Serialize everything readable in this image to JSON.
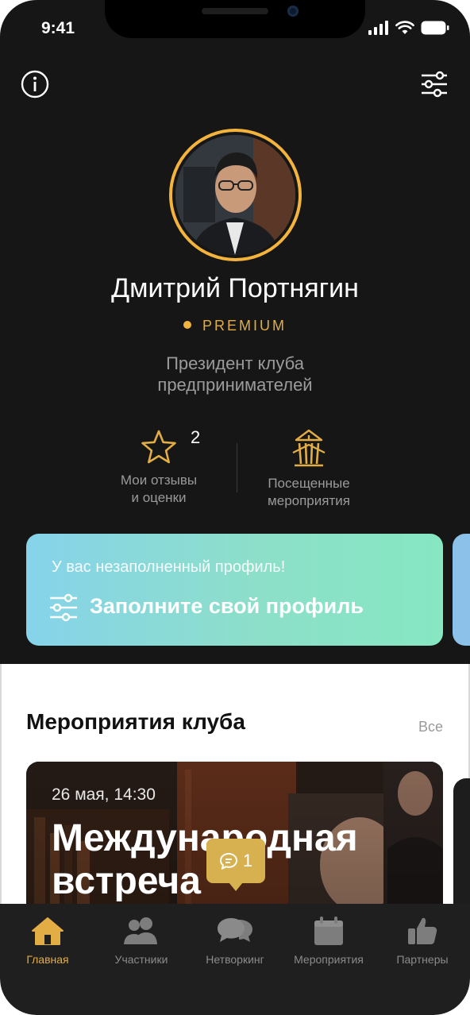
{
  "status_bar": {
    "time": "9:41"
  },
  "header": {
    "info_icon": "info-icon",
    "filter_icon": "filter-sliders-icon"
  },
  "profile": {
    "name": "Дмитрий Портнягин",
    "membership": "PREMIUM",
    "role_line1": "Президент клуба",
    "role_line2": "предпринимателей",
    "stats": [
      {
        "icon": "star-icon",
        "count": "2",
        "label_line1": "Мои отзывы",
        "label_line2": "и оценки"
      },
      {
        "icon": "events-building-icon",
        "label_line1": "Посещенные",
        "label_line2": "мероприятия"
      }
    ]
  },
  "profile_card": {
    "subtitle": "У вас незаполненный профиль!",
    "action": "Заполните свой профиль",
    "icon": "sliders-icon"
  },
  "events_section": {
    "title": "Мероприятия клуба",
    "all_link": "Все",
    "events": [
      {
        "date": "26 мая, 14:30",
        "title_line1": "Международная",
        "title_line2": "встреча"
      }
    ]
  },
  "chat_bubble": {
    "count": "1",
    "icon": "chat-icon"
  },
  "tabbar": {
    "tabs": [
      {
        "label": "Главная",
        "icon": "home-icon",
        "active": true
      },
      {
        "label": "Участники",
        "icon": "users-icon",
        "active": false
      },
      {
        "label": "Нетворкинг",
        "icon": "chat-bubbles-icon",
        "active": false
      },
      {
        "label": "Мероприятия",
        "icon": "calendar-icon",
        "active": false
      },
      {
        "label": "Партнеры",
        "icon": "thumbs-up-icon",
        "active": false
      }
    ]
  },
  "colors": {
    "accent_gold": "#E2AD45",
    "background_dark": "#161616",
    "tabbar": "#1F1F1F",
    "profile_card_gradient_start": "#86D3EA",
    "profile_card_gradient_end": "#86E7C2"
  }
}
